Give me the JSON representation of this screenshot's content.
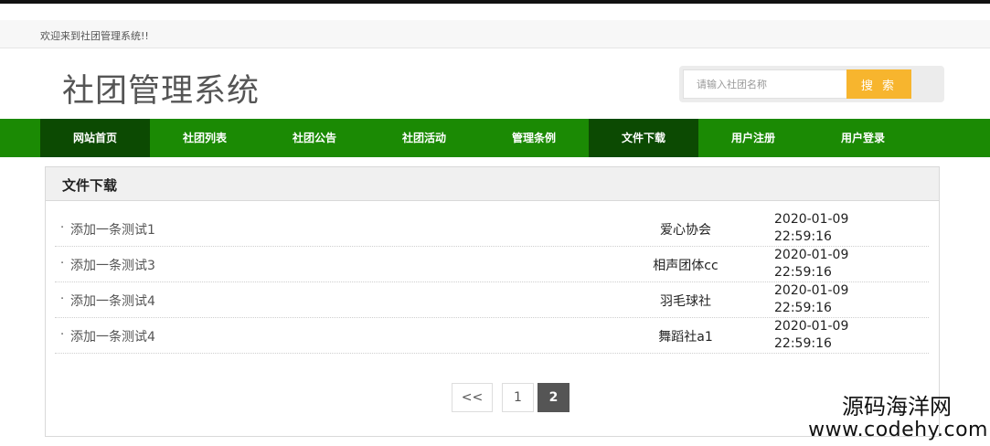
{
  "header": {
    "welcome": "欢迎来到社团管理系统!!",
    "site_title": "社团管理系统"
  },
  "search": {
    "placeholder": "请输入社团名称",
    "button_label": "搜 索"
  },
  "nav": {
    "items": [
      {
        "label": "网站首页",
        "active": true
      },
      {
        "label": "社团列表",
        "active": false
      },
      {
        "label": "社团公告",
        "active": false
      },
      {
        "label": "社团活动",
        "active": false
      },
      {
        "label": "管理条例",
        "active": false
      },
      {
        "label": "文件下载",
        "active": true
      },
      {
        "label": "用户注册",
        "active": false
      },
      {
        "label": "用户登录",
        "active": false
      }
    ]
  },
  "panel": {
    "title": "文件下载",
    "rows": [
      {
        "bullet": "·",
        "title": "添加一条测试1",
        "club": "爱心协会",
        "date": "2020-01-09",
        "time": "22:59:16"
      },
      {
        "bullet": "·",
        "title": "添加一条测试3",
        "club": "相声团体cc",
        "date": "2020-01-09",
        "time": "22:59:16"
      },
      {
        "bullet": "·",
        "title": "添加一条测试4",
        "club": "羽毛球社",
        "date": "2020-01-09",
        "time": "22:59:16"
      },
      {
        "bullet": "·",
        "title": "添加一条测试4",
        "club": "舞蹈社a1",
        "date": "2020-01-09",
        "time": "22:59:16"
      }
    ]
  },
  "pagination": {
    "prev": "<<",
    "pages": [
      "1",
      "2"
    ],
    "current": "2"
  },
  "watermark": {
    "line1": "源码海洋网",
    "line2": "www.codehy.com"
  },
  "colors": {
    "nav_bg": "#1b8a04",
    "nav_active_bg": "#0c4a02",
    "search_button": "#f7b52e",
    "page_current": "#555555"
  }
}
